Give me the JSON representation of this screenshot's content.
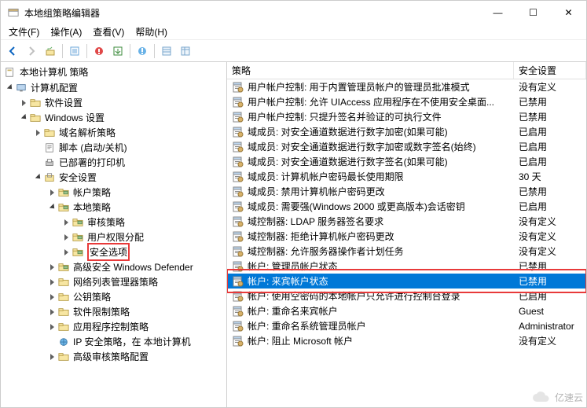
{
  "window": {
    "title": "本地组策略编辑器",
    "controls": {
      "minimize": "—",
      "maximize": "☐",
      "close": "✕"
    }
  },
  "menubar": {
    "items": [
      {
        "label": "文件(F)"
      },
      {
        "label": "操作(A)"
      },
      {
        "label": "查看(V)"
      },
      {
        "label": "帮助(H)"
      }
    ]
  },
  "toolbar": {
    "back": "←",
    "fwd": "→",
    "up": "↑",
    "props": "☰",
    "filter": "?",
    "refresh": "⟳",
    "help": "?"
  },
  "tree": {
    "root": "本地计算机 策略",
    "nodes": [
      {
        "indent": 1,
        "exp": "open",
        "label": "计算机配置",
        "icon": "computer"
      },
      {
        "indent": 2,
        "exp": "none",
        "label": "软件设置",
        "icon": "folder"
      },
      {
        "indent": 2,
        "exp": "open",
        "label": "Windows 设置",
        "icon": "folder"
      },
      {
        "indent": 3,
        "exp": "none",
        "label": "域名解析策略",
        "icon": "folder"
      },
      {
        "indent": 3,
        "exp": "none",
        "label": "脚本 (启动/关机)",
        "icon": "script"
      },
      {
        "indent": 3,
        "exp": "none",
        "label": "已部署的打印机",
        "icon": "printer"
      },
      {
        "indent": 3,
        "exp": "open",
        "label": "安全设置",
        "icon": "security"
      },
      {
        "indent": 4,
        "exp": "none",
        "label": "帐户策略",
        "icon": "folder-g"
      },
      {
        "indent": 4,
        "exp": "open",
        "label": "本地策略",
        "icon": "folder-g"
      },
      {
        "indent": 5,
        "exp": "none",
        "label": "审核策略",
        "icon": "folder-g"
      },
      {
        "indent": 5,
        "exp": "none",
        "label": "用户权限分配",
        "icon": "folder-g"
      },
      {
        "indent": 5,
        "exp": "none",
        "label": "安全选项",
        "icon": "folder-g",
        "redbox": true
      },
      {
        "indent": 4,
        "exp": "none",
        "label": "高级安全 Windows Defender",
        "icon": "folder-g"
      },
      {
        "indent": 4,
        "exp": "none",
        "label": "网络列表管理器策略",
        "icon": "folder"
      },
      {
        "indent": 4,
        "exp": "none",
        "label": "公钥策略",
        "icon": "folder"
      },
      {
        "indent": 4,
        "exp": "none",
        "label": "软件限制策略",
        "icon": "folder"
      },
      {
        "indent": 4,
        "exp": "none",
        "label": "应用程序控制策略",
        "icon": "folder"
      },
      {
        "indent": 4,
        "exp": "none",
        "label": "IP 安全策略，在 本地计算机",
        "icon": "ipsec"
      },
      {
        "indent": 4,
        "exp": "none",
        "label": "高级审核策略配置",
        "icon": "folder"
      }
    ]
  },
  "list": {
    "columns": {
      "policy": "策略",
      "setting": "安全设置"
    },
    "rows": [
      {
        "policy": "用户帐户控制: 用于内置管理员帐户的管理员批准模式",
        "setting": "没有定义"
      },
      {
        "policy": "用户帐户控制: 允许 UIAccess 应用程序在不使用安全桌面...",
        "setting": "已禁用"
      },
      {
        "policy": "用户帐户控制: 只提升签名并验证的可执行文件",
        "setting": "已禁用"
      },
      {
        "policy": "域成员: 对安全通道数据进行数字加密(如果可能)",
        "setting": "已启用"
      },
      {
        "policy": "域成员: 对安全通道数据进行数字加密或数字签名(始终)",
        "setting": "已启用"
      },
      {
        "policy": "域成员: 对安全通道数据进行数字签名(如果可能)",
        "setting": "已启用"
      },
      {
        "policy": "域成员: 计算机帐户密码最长使用期限",
        "setting": "30 天"
      },
      {
        "policy": "域成员: 禁用计算机帐户密码更改",
        "setting": "已禁用"
      },
      {
        "policy": "域成员: 需要强(Windows 2000 或更高版本)会话密钥",
        "setting": "已启用"
      },
      {
        "policy": "域控制器: LDAP 服务器签名要求",
        "setting": "没有定义"
      },
      {
        "policy": "域控制器: 拒绝计算机帐户密码更改",
        "setting": "没有定义"
      },
      {
        "policy": "域控制器: 允许服务器操作者计划任务",
        "setting": "没有定义"
      },
      {
        "policy": "帐户: 管理员帐户状态",
        "setting": "已禁用"
      },
      {
        "policy": "帐户: 来宾帐户状态",
        "setting": "已禁用",
        "selected": true,
        "redbox": true
      },
      {
        "policy": "帐户: 使用空密码的本地帐户只允许进行控制台登录",
        "setting": "已启用"
      },
      {
        "policy": "帐户: 重命名来宾帐户",
        "setting": "Guest"
      },
      {
        "policy": "帐户: 重命名系统管理员帐户",
        "setting": "Administrator"
      },
      {
        "policy": "帐户: 阻止 Microsoft 帐户",
        "setting": "没有定义"
      }
    ]
  },
  "watermark": {
    "text": "亿速云"
  }
}
